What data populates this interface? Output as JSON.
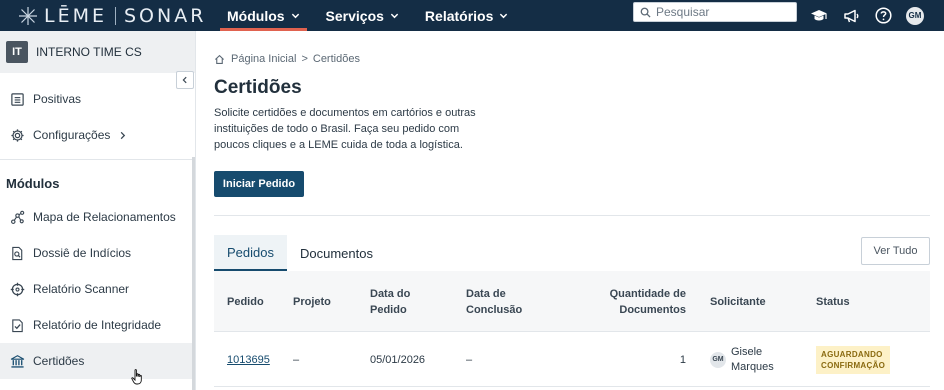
{
  "topbar": {
    "brand_left": "LĒME",
    "brand_right": "SONAR",
    "nav": [
      {
        "label": "Módulos",
        "active": true
      },
      {
        "label": "Serviços",
        "active": false
      },
      {
        "label": "Relatórios",
        "active": false
      }
    ],
    "search_placeholder": "Pesquisar",
    "avatar": "GM"
  },
  "sidebar": {
    "org_badge": "IT",
    "org_name": "INTERNO TIME CS",
    "top_items": [
      {
        "label": "Positivas",
        "icon": "list-icon"
      },
      {
        "label": "Configurações",
        "icon": "gear-icon"
      }
    ],
    "section_title": "Módulos",
    "modules": [
      {
        "label": "Mapa de Relacionamentos",
        "icon": "network-icon"
      },
      {
        "label": "Dossiê de Indícios",
        "icon": "document-search-icon"
      },
      {
        "label": "Relatório Scanner",
        "icon": "crosshair-icon"
      },
      {
        "label": "Relatório de Integridade",
        "icon": "checklist-icon"
      },
      {
        "label": "Certidões",
        "icon": "bank-icon",
        "active": true
      }
    ]
  },
  "breadcrumb": {
    "home": "Página Inicial",
    "current": "Certidões"
  },
  "page": {
    "title": "Certidões",
    "description": "Solicite certidões e documentos em cartórios e outras instituições de todo o Brasil. Faça seu pedido com poucos cliques e a LEME cuida de toda a logística.",
    "primary_button": "Iniciar Pedido"
  },
  "tabs": [
    {
      "label": "Pedidos",
      "active": true
    },
    {
      "label": "Documentos",
      "active": false
    }
  ],
  "view_all_button": "Ver Tudo",
  "table": {
    "headers": {
      "pedido": "Pedido",
      "projeto": "Projeto",
      "data_pedido_1": "Data do",
      "data_pedido_2": "Pedido",
      "data_conclusao_1": "Data de",
      "data_conclusao_2": "Conclusão",
      "quantidade_1": "Quantidade de",
      "quantidade_2": "Documentos",
      "solicitante": "Solicitante",
      "status": "Status"
    },
    "rows": [
      {
        "pedido": "1013695",
        "projeto": "–",
        "data_pedido": "05/01/2026",
        "data_conclusao": "–",
        "quantidade": "1",
        "solicitante_initials": "GM",
        "solicitante_1": "Gisele",
        "solicitante_2": "Marques",
        "status_1": "AGUARDANDO",
        "status_2": "CONFIRMAÇÃO"
      }
    ]
  },
  "colors": {
    "topbar": "#142d45",
    "nav_active_underline": "#e0624f",
    "primary": "#164b6e",
    "status_badge_bg": "#fdf1c7"
  }
}
